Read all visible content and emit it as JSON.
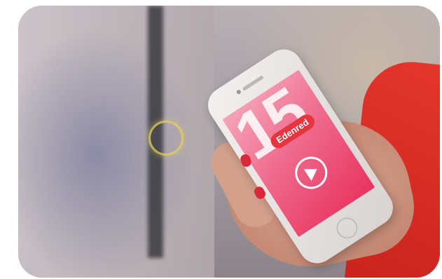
{
  "photo": {
    "screen_number": "15",
    "logo_text": "Edenred",
    "colors": {
      "brand_red": "#e8343d",
      "screen_pink": "#ef6a8d",
      "sleeve_red": "#d62b24",
      "phone_white": "#f4f0ef"
    },
    "icons": [
      "play-icon",
      "home-button-icon"
    ]
  }
}
